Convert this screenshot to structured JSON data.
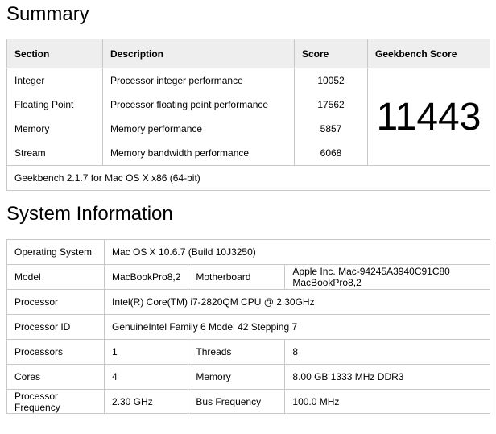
{
  "summary": {
    "title": "Summary",
    "headers": {
      "section": "Section",
      "description": "Description",
      "score": "Score",
      "geekbench": "Geekbench Score"
    },
    "rows": [
      {
        "section": "Integer",
        "description": "Processor integer performance",
        "score": "10052"
      },
      {
        "section": "Floating Point",
        "description": "Processor floating point performance",
        "score": "17562"
      },
      {
        "section": "Memory",
        "description": "Memory performance",
        "score": "5857"
      },
      {
        "section": "Stream",
        "description": "Memory bandwidth performance",
        "score": "6068"
      }
    ],
    "geekbench_score": "11443",
    "footer": "Geekbench 2.1.7 for Mac OS X x86 (64-bit)"
  },
  "sysinfo": {
    "title": "System Information",
    "os_label": "Operating System",
    "os_value": "Mac OS X 10.6.7 (Build 10J3250)",
    "model_label": "Model",
    "model_value": "MacBookPro8,2",
    "motherboard_label": "Motherboard",
    "motherboard_value_1": "Apple Inc. Mac-94245A3940C91C80",
    "motherboard_value_2": "MacBookPro8,2",
    "processor_label": "Processor",
    "processor_value": "Intel(R) Core(TM) i7-2820QM CPU @ 2.30GHz",
    "processor_id_label": "Processor ID",
    "processor_id_value": "GenuineIntel Family 6 Model 42 Stepping 7",
    "processors_label": "Processors",
    "processors_value": "1",
    "threads_label": "Threads",
    "threads_value": "8",
    "cores_label": "Cores",
    "cores_value": "4",
    "memory_label": "Memory",
    "memory_value": "8.00 GB  1333 MHz DDR3",
    "freq_label_1": "Processor",
    "freq_label_2": "Frequency",
    "freq_value": "2.30 GHz",
    "bus_label": "Bus Frequency",
    "bus_value": "100.0 MHz"
  }
}
